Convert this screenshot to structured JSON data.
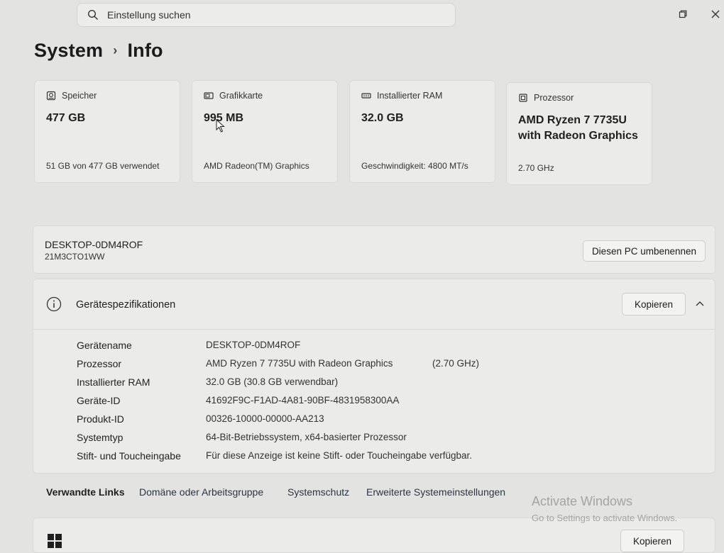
{
  "search": {
    "placeholder": "Einstellung suchen"
  },
  "window": {
    "maximize": "maximize-icon",
    "close": "close-icon"
  },
  "breadcrumb": {
    "parent": "System",
    "separator": "›",
    "current": "Info"
  },
  "cards": [
    {
      "title": "Speicher",
      "value": "477 GB",
      "sub": "51 GB von 477 GB verwendet"
    },
    {
      "title": "Grafikkarte",
      "value": "995 MB",
      "sub": "AMD Radeon(TM) Graphics"
    },
    {
      "title": "Installierter RAM",
      "value": "32.0 GB",
      "sub": "Geschwindigkeit: 4800 MT/s"
    },
    {
      "title": "Prozessor",
      "value": "AMD Ryzen 7 7735U with Radeon Graphics",
      "sub": "2.70 GHz"
    }
  ],
  "device": {
    "name": "DESKTOP-0DM4ROF",
    "model": "21M3CTO1WW",
    "rename_label": "Diesen PC umbenennen"
  },
  "specs": {
    "title": "Gerätespezifikationen",
    "copy_label": "Kopieren",
    "rows": [
      {
        "label": "Gerätename",
        "value": "DESKTOP-0DM4ROF",
        "extra": ""
      },
      {
        "label": "Prozessor",
        "value": "AMD Ryzen 7 7735U with Radeon Graphics",
        "extra": "(2.70 GHz)"
      },
      {
        "label": "Installierter RAM",
        "value": "32.0 GB (30.8 GB verwendbar)",
        "extra": ""
      },
      {
        "label": "Geräte-ID",
        "value": "41692F9C-F1AD-4A81-90BF-4831958300AA",
        "extra": ""
      },
      {
        "label": "Produkt-ID",
        "value": "00326-10000-00000-AA213",
        "extra": ""
      },
      {
        "label": "Systemtyp",
        "value": "64-Bit-Betriebssystem, x64-basierter Prozessor",
        "extra": ""
      },
      {
        "label": "Stift- und Toucheingabe",
        "value": "Für diese Anzeige ist keine Stift- oder Toucheingabe verfügbar.",
        "extra": ""
      }
    ]
  },
  "related": {
    "title": "Verwandte Links",
    "links": [
      "Domäne oder Arbeitsgruppe",
      "Systemschutz",
      "Erweiterte Systemeinstellungen"
    ]
  },
  "windows_specs": {
    "copy_label": "Kopieren"
  },
  "watermark": {
    "line1": "Activate Windows",
    "line2": "Go to Settings to activate Windows."
  },
  "colors": {
    "background": "#e3e4e2",
    "card": "#ebecea",
    "border": "#d9dad8"
  }
}
